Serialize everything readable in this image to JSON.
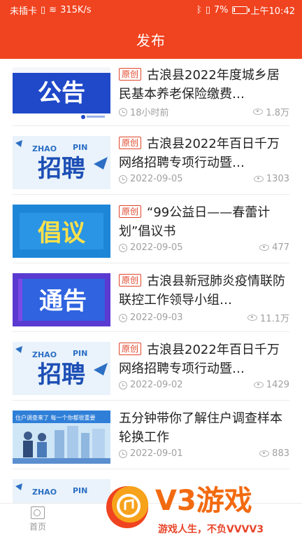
{
  "status_bar": {
    "carrier": "未插卡",
    "speed": "315K/s",
    "battery": "7%",
    "time": "上午10:42"
  },
  "header": {
    "title": "发布"
  },
  "colors": {
    "accent": "#f0431f",
    "tag": "#e0452a"
  },
  "articles": [
    {
      "thumb_text": "公告",
      "tag": "原创",
      "title": "古浪县2022年度城乡居民基本养老保险缴费…",
      "time": "18小时前",
      "views": "1.8万"
    },
    {
      "thumb_text": "招聘",
      "thumb_sub_left": "ZHAO",
      "thumb_sub_right": "PIN",
      "tag": "原创",
      "title": "古浪县2022年百日千万网络招聘专项行动暨…",
      "time": "2022-09-05",
      "views": "1303"
    },
    {
      "thumb_text": "倡议",
      "tag": "原创",
      "title": "“99公益日——春蕾计划”倡议书",
      "time": "2022-09-05",
      "views": "477"
    },
    {
      "thumb_text": "通告",
      "tag": "原创",
      "title": "古浪县新冠肺炎疫情联防联控工作领导小组…",
      "time": "2022-09-03",
      "views": "11.1万"
    },
    {
      "thumb_text": "招聘",
      "thumb_sub_left": "ZHAO",
      "thumb_sub_right": "PIN",
      "tag": "原创",
      "title": "古浪县2022年百日千万网络招聘专项行动暨…",
      "time": "2022-09-02",
      "views": "1429"
    },
    {
      "thumb_text": "住户调查来了 每一个你都很重要",
      "title": "五分钟带你了解住户调查样本轮换工作",
      "time": "2022-09-01",
      "views": "883"
    },
    {
      "thumb_sub_left": "ZHAO",
      "thumb_sub_right": "PIN"
    }
  ],
  "tabbar": {
    "home_label": "首页"
  },
  "watermark": {
    "brand": "V3游戏",
    "slogan": "游戏人生，不负VVVV3"
  }
}
